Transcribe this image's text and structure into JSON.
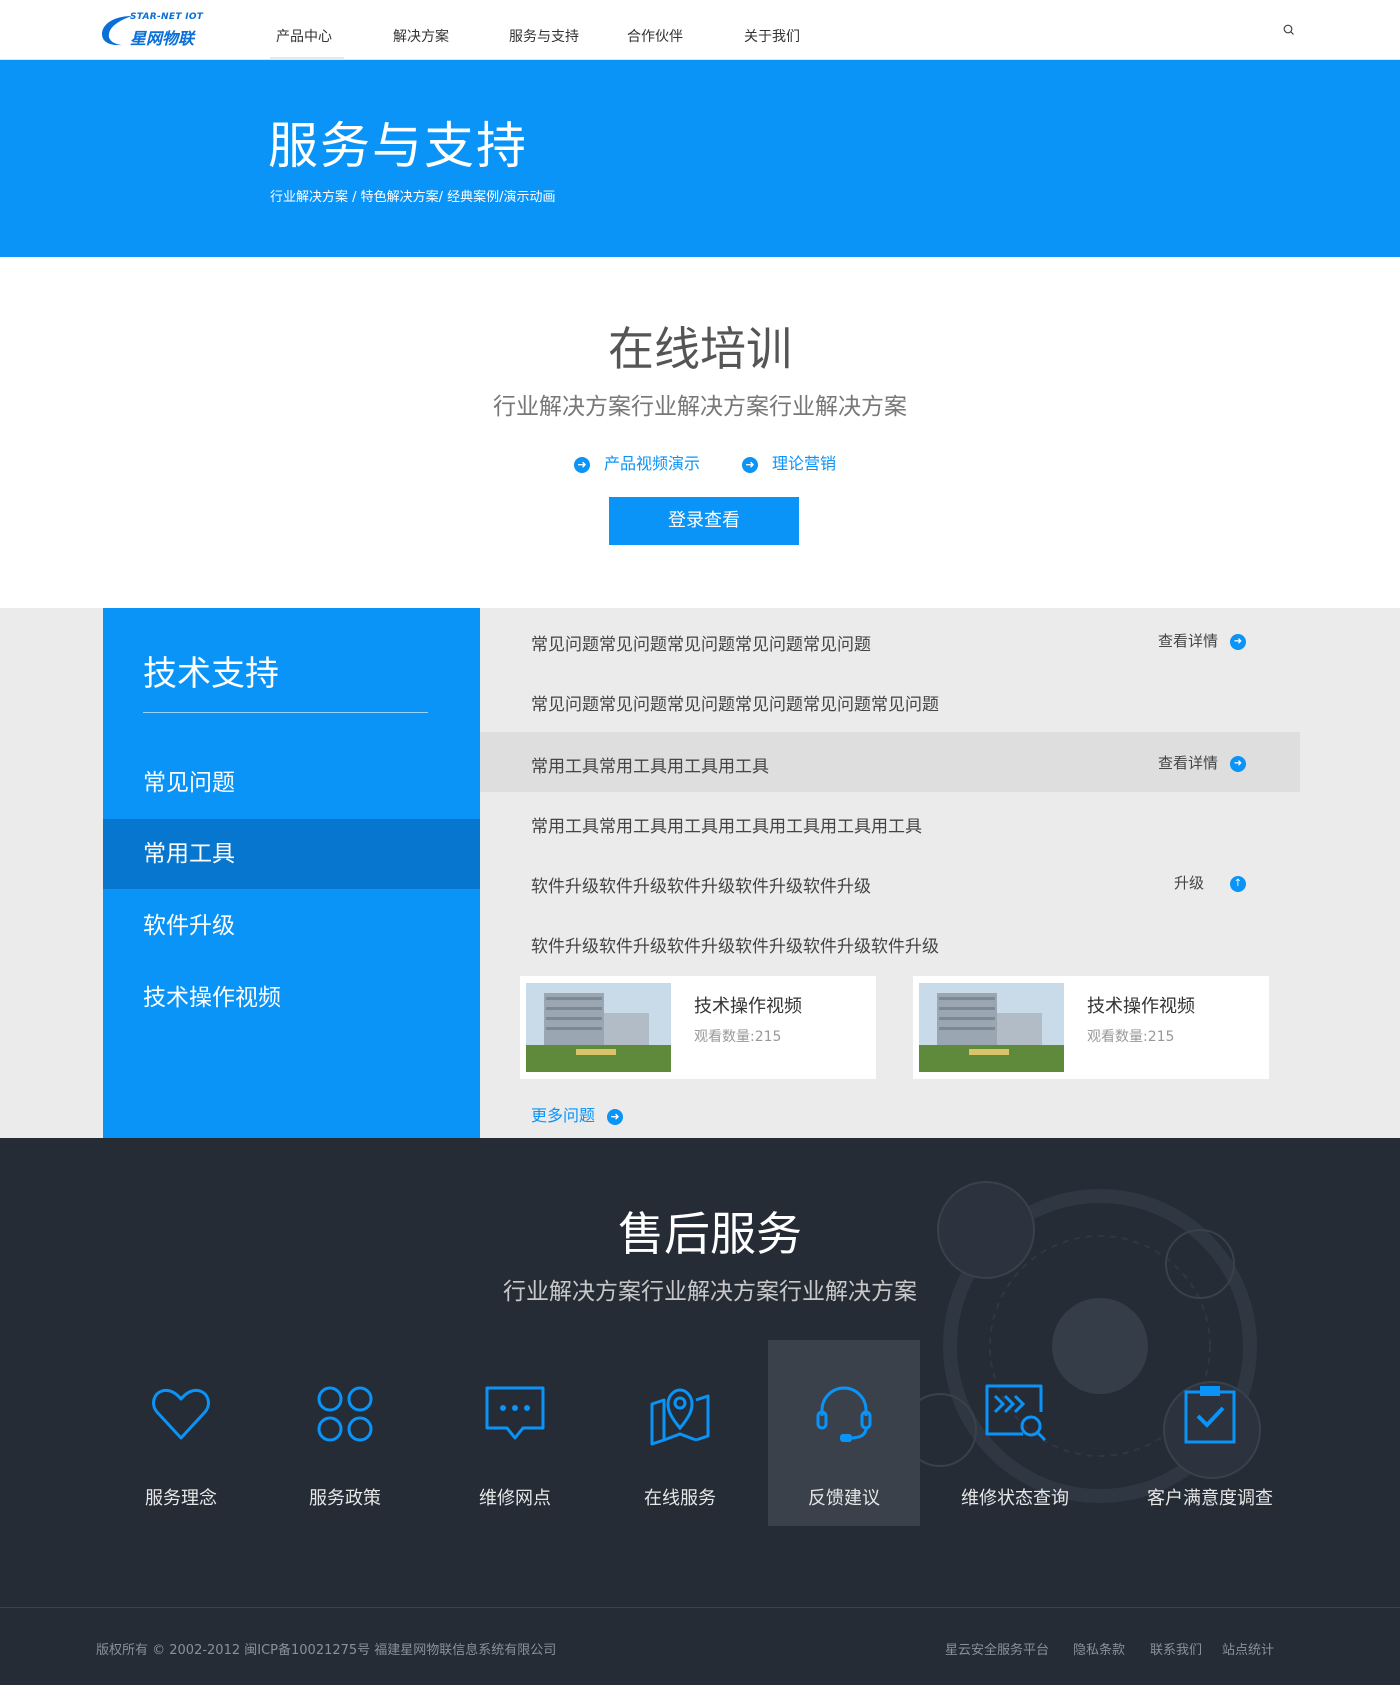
{
  "header": {
    "logo_en": "STAR-NET IOT",
    "logo_cn": "星网物联",
    "nav": [
      {
        "label": "产品中心"
      },
      {
        "label": "解决方案"
      },
      {
        "label": "服务与支持"
      },
      {
        "label": "合作伙伴"
      },
      {
        "label": "关于我们"
      }
    ]
  },
  "banner": {
    "title": "服务与支持",
    "subtitle": "行业解决方案 / 特色解决方案/ 经典案例/演示动画"
  },
  "training": {
    "title": "在线培训",
    "subtitle": "行业解决方案行业解决方案行业解决方案",
    "links": [
      {
        "label": "产品视频演示"
      },
      {
        "label": "理论营销"
      }
    ],
    "login_label": "登录查看"
  },
  "support": {
    "title": "技术支持",
    "menu": [
      {
        "label": "常见问题"
      },
      {
        "label": "常用工具",
        "active": true
      },
      {
        "label": "软件升级"
      },
      {
        "label": "技术操作视频"
      }
    ],
    "rows": [
      {
        "text": "常见问题常见问题常见问题常见问题常见问题",
        "action": "查看详情"
      },
      {
        "text": "常见问题常见问题常见问题常见问题常见问题常见问题",
        "action": ""
      },
      {
        "text": "常用工具常用工具用工具用工具",
        "action": "查看详情"
      },
      {
        "text": "常用工具常用工具用工具用工具用工具用工具用工具",
        "action": ""
      },
      {
        "text": "软件升级软件升级软件升级软件升级软件升级",
        "action": "升级"
      },
      {
        "text": "软件升级软件升级软件升级软件升级软件升级软件升级",
        "action": ""
      }
    ],
    "videos": [
      {
        "title": "技术操作视频",
        "views": "观看数量:215"
      },
      {
        "title": "技术操作视频",
        "views": "观看数量:215"
      }
    ],
    "more_label": "更多问题"
  },
  "aftersales": {
    "title": "售后服务",
    "subtitle": "行业解决方案行业解决方案行业解决方案",
    "services": [
      {
        "label": "服务理念",
        "icon": "heart-icon"
      },
      {
        "label": "服务政策",
        "icon": "grid-icon"
      },
      {
        "label": "维修网点",
        "icon": "chat-icon"
      },
      {
        "label": "在线服务",
        "icon": "map-pin-icon"
      },
      {
        "label": "反馈建议",
        "icon": "headset-icon",
        "active": true
      },
      {
        "label": "维修状态查询",
        "icon": "search-status-icon"
      },
      {
        "label": "客户满意度调查",
        "icon": "clipboard-check-icon"
      }
    ]
  },
  "footer": {
    "copyright": "版权所有 © 2002-2012 闽ICP备10021275号 福建星网物联信息系统有限公司",
    "links": [
      {
        "label": "星云安全服务平台"
      },
      {
        "label": "隐私条款"
      },
      {
        "label": "联系我们"
      },
      {
        "label": "站点统计"
      }
    ]
  },
  "colors": {
    "primary": "#0a94f8",
    "primary_dark": "#0676cf",
    "dark_bg": "#252c36"
  }
}
